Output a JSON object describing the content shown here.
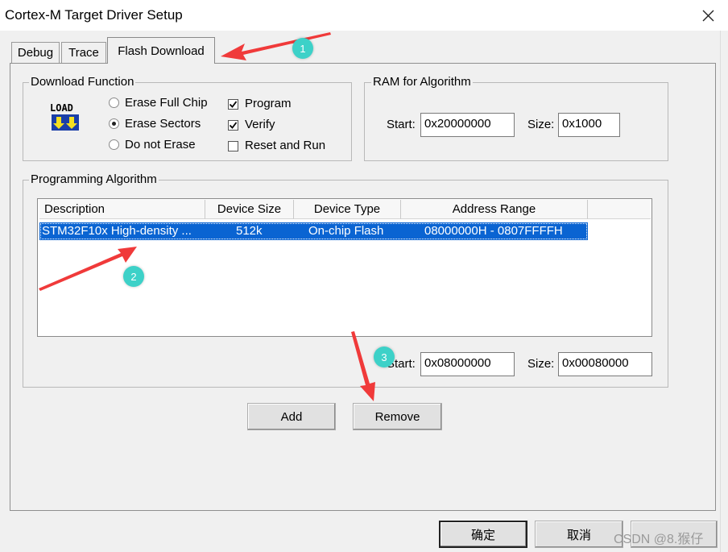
{
  "window": {
    "title": "Cortex-M Target Driver Setup"
  },
  "tabs": [
    {
      "label": "Debug"
    },
    {
      "label": "Trace"
    },
    {
      "label": "Flash Download"
    }
  ],
  "download_function": {
    "title": "Download Function",
    "icon_text": "LOAD",
    "radios": [
      {
        "label": "Erase Full Chip",
        "selected": false
      },
      {
        "label": "Erase Sectors",
        "selected": true
      },
      {
        "label": "Do not Erase",
        "selected": false
      }
    ],
    "checks": [
      {
        "label": "Program",
        "checked": true
      },
      {
        "label": "Verify",
        "checked": true
      },
      {
        "label": "Reset and Run",
        "checked": false
      }
    ]
  },
  "ram_for_algorithm": {
    "title": "RAM for Algorithm",
    "start_label": "Start:",
    "start_value": "0x20000000",
    "size_label": "Size:",
    "size_value": "0x1000"
  },
  "programming_algorithm": {
    "title": "Programming Algorithm",
    "columns": [
      "Description",
      "Device Size",
      "Device Type",
      "Address Range"
    ],
    "rows": [
      {
        "description": "STM32F10x High-density ...",
        "device_size": "512k",
        "device_type": "On-chip Flash",
        "address_range": "08000000H - 0807FFFFH"
      }
    ],
    "start_label": "Start:",
    "start_value": "0x08000000",
    "size_label": "Size:",
    "size_value": "0x00080000",
    "add_label": "Add",
    "remove_label": "Remove"
  },
  "footer": {
    "ok_label": "确定",
    "cancel_label": "取消"
  },
  "annotations": {
    "badges": [
      "1",
      "2",
      "3"
    ],
    "arrow_color": "#f03a3a",
    "badge_color": "#3dd1c8"
  },
  "watermark": "CSDN @8.猴仔"
}
